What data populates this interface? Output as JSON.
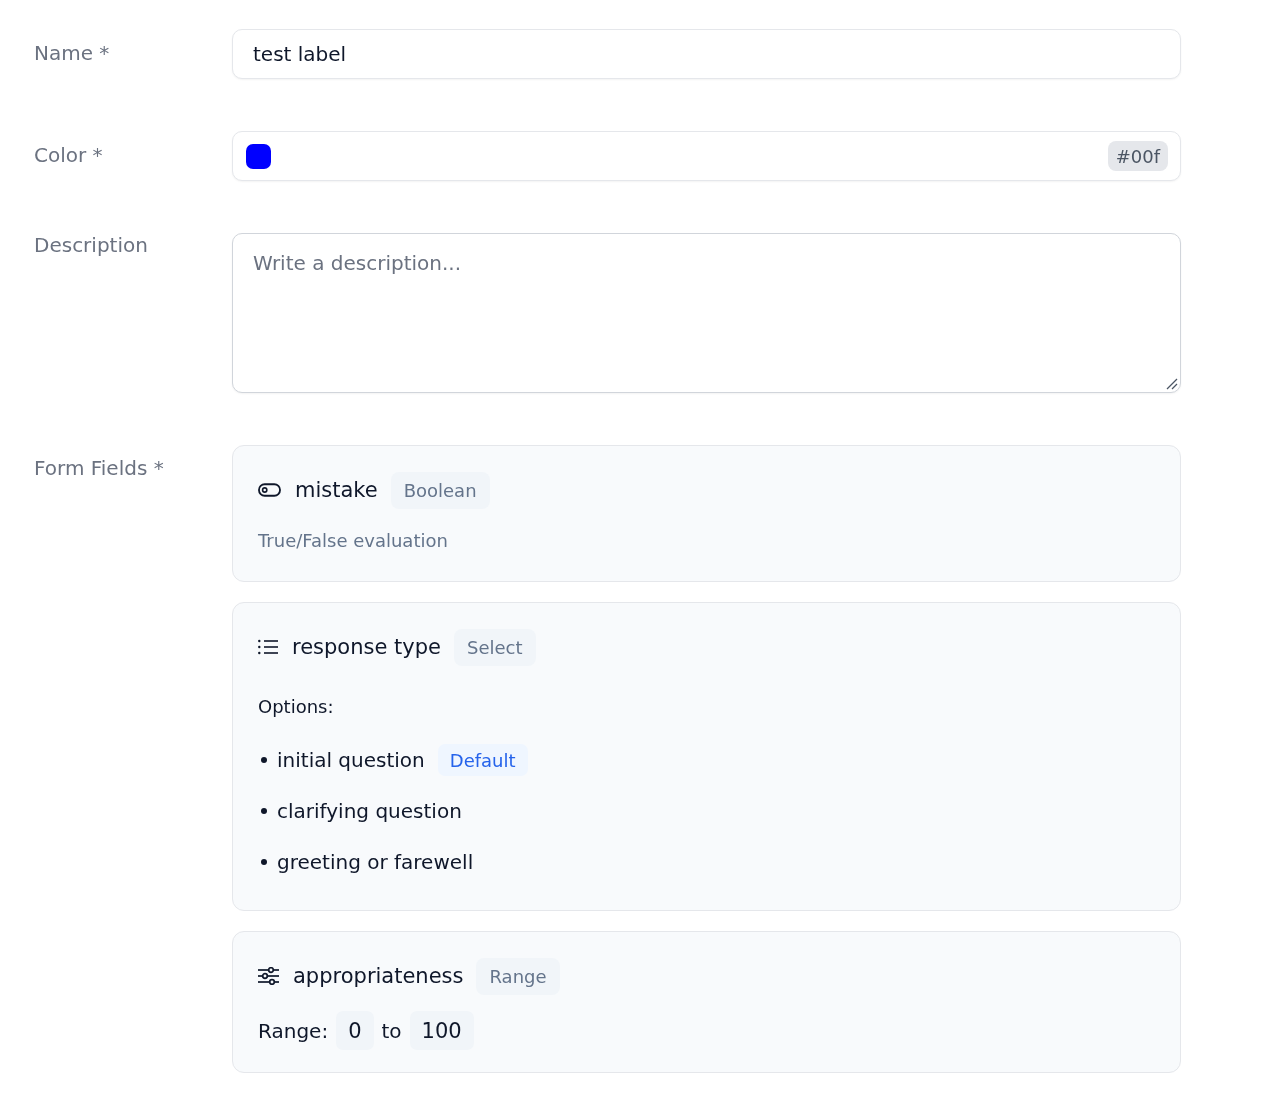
{
  "fields": [
    {
      "kind": "text",
      "label": "Name *",
      "value": "test label"
    },
    {
      "kind": "color",
      "label": "Color *",
      "color": "#0000ff",
      "value": "#00f"
    },
    {
      "kind": "textarea",
      "label": "Description",
      "placeholder": "Write a description..."
    },
    {
      "kind": "field_list",
      "label": "Form Fields *",
      "items": [
        {
          "kind": "boolean",
          "name": "mistake",
          "type": "Boolean",
          "description": "True/False evaluation"
        },
        {
          "kind": "select",
          "name": "response type",
          "type": "Select",
          "options_heading": "Options:",
          "options": [
            {
              "label": "initial question",
              "default": true,
              "badge": "Default"
            },
            {
              "label": "clarifying question",
              "default": false
            },
            {
              "label": "greeting or farewell",
              "default": false
            }
          ]
        },
        {
          "kind": "range",
          "name": "appropriateness",
          "type": "Range",
          "range_label": "Range:",
          "min": "0",
          "separator": "to",
          "max": "100"
        }
      ]
    }
  ]
}
